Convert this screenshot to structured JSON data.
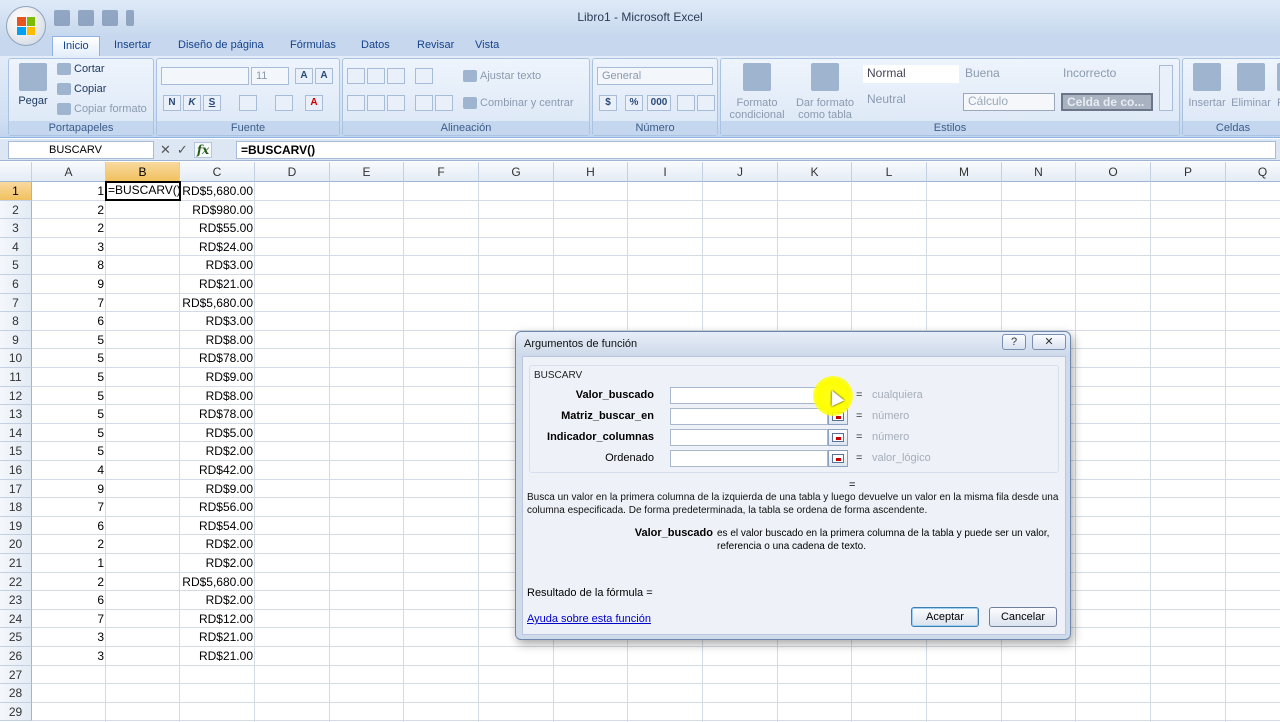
{
  "window": {
    "title": "Libro1 - Microsoft Excel"
  },
  "tabs": [
    "Inicio",
    "Insertar",
    "Diseño de página",
    "Fórmulas",
    "Datos",
    "Revisar",
    "Vista"
  ],
  "ribbon": {
    "clipboard": {
      "paste": "Pegar",
      "cut": "Cortar",
      "copy": "Copiar",
      "format_painter": "Copiar formato",
      "label": "Portapapeles"
    },
    "font": {
      "size": "11",
      "label": "Fuente",
      "bold": "N",
      "italic": "K",
      "underline": "S"
    },
    "alignment": {
      "wrap": "Ajustar texto",
      "merge": "Combinar y centrar",
      "label": "Alineación"
    },
    "number": {
      "format": "General",
      "label": "Número",
      "currency": "$",
      "percent": "%",
      "thousands": "000"
    },
    "styles": {
      "conditional": "Formato condicional",
      "table": "Dar formato como tabla",
      "normal": "Normal",
      "good": "Buena",
      "bad": "Incorrecto",
      "neutral": "Neutral",
      "calc": "Cálculo",
      "check": "Celda de co...",
      "label": "Estilos"
    },
    "cells": {
      "insert": "Insertar",
      "delete": "Eliminar",
      "format": "Fo",
      "label": "Celdas"
    }
  },
  "formula_bar": {
    "name_box": "BUSCARV",
    "fx": "fx",
    "formula": "=BUSCARV()"
  },
  "columns": [
    "A",
    "B",
    "C",
    "D",
    "E",
    "F",
    "G",
    "H",
    "I",
    "J",
    "K",
    "L",
    "M",
    "N",
    "O",
    "P",
    "Q"
  ],
  "rows": [
    "1",
    "2",
    "3",
    "4",
    "5",
    "6",
    "7",
    "8",
    "9",
    "10",
    "11",
    "12",
    "13",
    "14",
    "15",
    "16",
    "17",
    "18",
    "19",
    "20",
    "21",
    "22",
    "23",
    "24",
    "25",
    "26",
    "27",
    "28",
    "29"
  ],
  "col_a": [
    "1",
    "2",
    "2",
    "3",
    "8",
    "9",
    "7",
    "6",
    "5",
    "5",
    "5",
    "5",
    "5",
    "5",
    "5",
    "4",
    "9",
    "7",
    "6",
    "2",
    "1",
    "2",
    "6",
    "7",
    "3",
    "3"
  ],
  "col_c": [
    "RD$5,680.00",
    "RD$980.00",
    "RD$55.00",
    "RD$24.00",
    "RD$3.00",
    "RD$21.00",
    "RD$5,680.00",
    "RD$3.00",
    "RD$8.00",
    "RD$78.00",
    "RD$9.00",
    "RD$8.00",
    "RD$78.00",
    "RD$5.00",
    "RD$2.00",
    "RD$42.00",
    "RD$9.00",
    "RD$56.00",
    "RD$54.00",
    "RD$2.00",
    "RD$2.00",
    "RD$5,680.00",
    "RD$2.00",
    "RD$12.00",
    "RD$21.00",
    "RD$21.00"
  ],
  "active_cell": {
    "ref": "B1",
    "content": "=BUSCARV()"
  },
  "dialog": {
    "title": "Argumentos de función",
    "help_btn": "?",
    "close_btn": "✕",
    "function_name": "BUSCARV",
    "args": [
      {
        "label": "Valor_buscado",
        "value": "cualquiera"
      },
      {
        "label": "Matriz_buscar_en",
        "value": "número"
      },
      {
        "label": "Indicador_columnas",
        "value": "número"
      },
      {
        "label": "Ordenado",
        "value": "valor_lógico"
      }
    ],
    "equals": "=",
    "description": "Busca un valor en la primera columna de la izquierda de una tabla y luego devuelve un valor en la misma fila desde una columna especificada. De forma predeterminada, la tabla se ordena de forma ascendente.",
    "arg_name": "Valor_buscado",
    "arg_description": "es el valor buscado en la primera columna de la tabla y puede ser un valor, referencia o una cadena de texto.",
    "result_label": "Resultado de la fórmula =",
    "help_link": "Ayuda sobre esta función",
    "ok": "Aceptar",
    "cancel": "Cancelar"
  },
  "colors": {
    "selected_header": "#f1c15f",
    "highlight": "#ffff00",
    "ribbon_text": "#15428b"
  }
}
